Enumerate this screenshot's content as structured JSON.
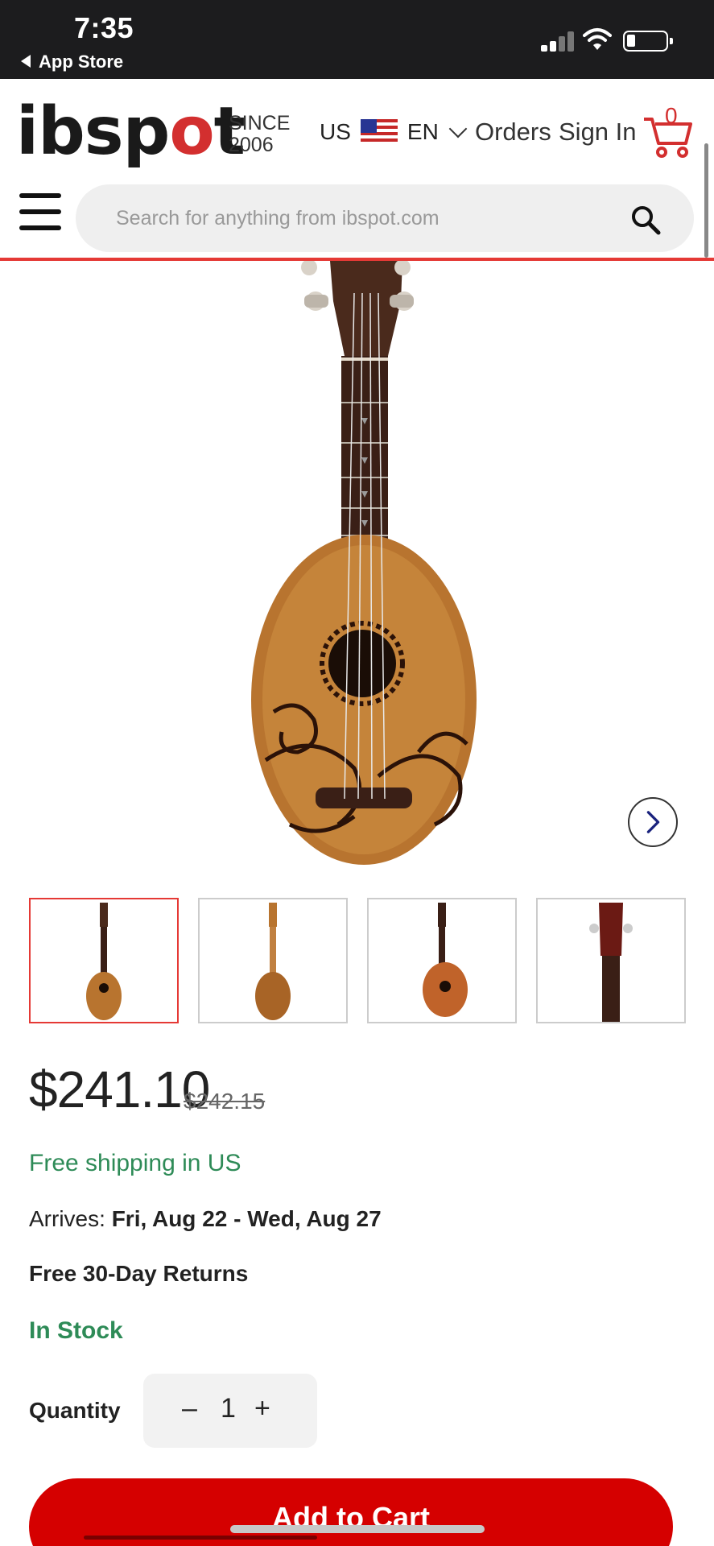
{
  "status_bar": {
    "time": "7:35",
    "back_label": "App Store"
  },
  "header": {
    "logo_prefix": "ibsp",
    "logo_o": "o",
    "logo_suffix": "t",
    "since_line1": "SINCE",
    "since_line2": "2006",
    "country": "US",
    "language": "EN",
    "orders_label": "Orders",
    "signin_label": "Sign In",
    "cart_count": "0"
  },
  "search": {
    "placeholder": "Search for anything from ibspot.com"
  },
  "product": {
    "price": "$241.10",
    "old_price": "$242.15",
    "shipping": "Free shipping in US",
    "arrives_label": "Arrives:",
    "arrives_dates": "Fri, Aug 22 - Wed, Aug 27",
    "returns": "Free 30-Day Returns",
    "stock": "In Stock",
    "quantity_label": "Quantity",
    "quantity_value": "1",
    "add_to_cart": "Add to Cart"
  },
  "colors": {
    "brand_red": "#d32f2f",
    "cta_red": "#d50000",
    "success_green": "#2e8b57"
  },
  "icons": [
    "chevron-left-icon",
    "signal-icon",
    "wifi-icon",
    "battery-icon",
    "flag-us-icon",
    "chevron-down-icon",
    "cart-icon",
    "menu-icon",
    "search-icon",
    "chevron-right-icon"
  ]
}
